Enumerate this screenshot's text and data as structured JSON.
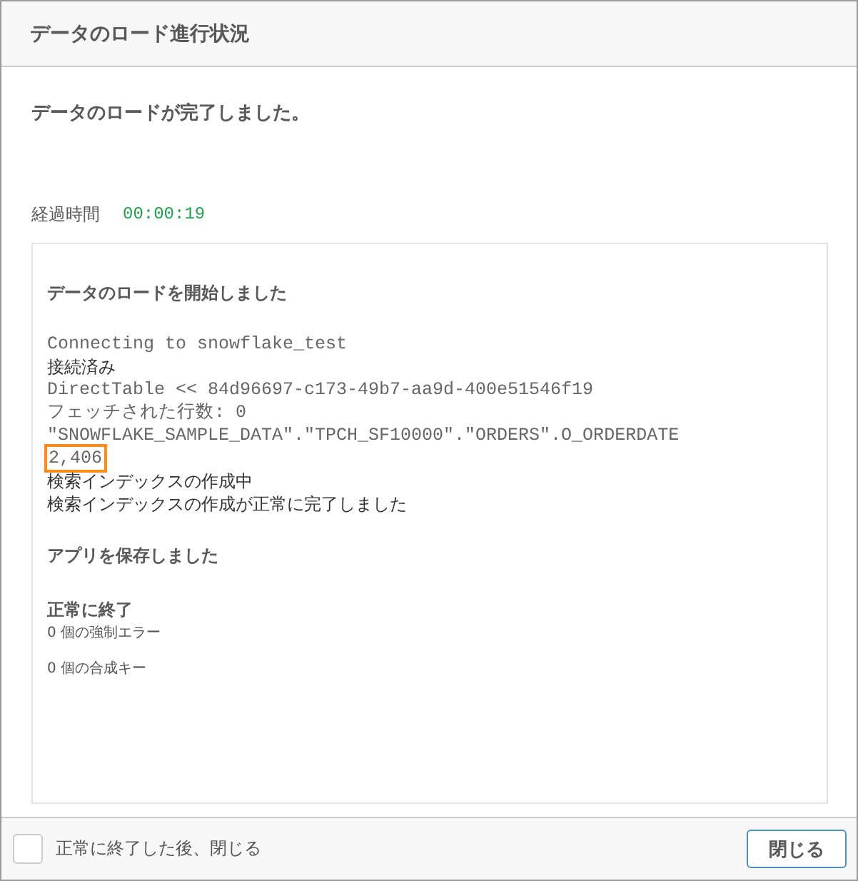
{
  "window": {
    "title": "データのロード進行状況"
  },
  "status": "データのロードが完了しました。",
  "elapsed": {
    "label": "経過時間",
    "value": "00:00:19"
  },
  "log": [
    {
      "kind": "heading",
      "text": "データのロードを開始しました"
    },
    {
      "kind": "gap"
    },
    {
      "kind": "code",
      "text": "Connecting to snowflake_test",
      "highlighted": false
    },
    {
      "kind": "text",
      "text": "接続済み"
    },
    {
      "kind": "code",
      "text": "DirectTable << 84d96697-c173-49b7-aa9d-400e51546f19",
      "highlighted": false
    },
    {
      "kind": "code",
      "text": "フェッチされた行数: 0",
      "highlighted": false
    },
    {
      "kind": "code",
      "text": "\"SNOWFLAKE_SAMPLE_DATA\".\"TPCH_SF10000\".\"ORDERS\".O_ORDERDATE",
      "highlighted": false
    },
    {
      "kind": "code",
      "text": "2,406",
      "highlighted": true
    },
    {
      "kind": "text",
      "text": "検索インデックスの作成中"
    },
    {
      "kind": "text",
      "text": "検索インデックスの作成が正常に完了しました"
    },
    {
      "kind": "gap"
    },
    {
      "kind": "heading",
      "text": "アプリを保存しました"
    },
    {
      "kind": "gap"
    },
    {
      "kind": "heading",
      "text": "正常に終了"
    },
    {
      "kind": "count",
      "text": "0 個の強制エラー"
    },
    {
      "kind": "count",
      "text": "0 個の合成キー"
    }
  ],
  "footer": {
    "checkbox": {
      "label": "正常に終了した後、閉じる",
      "checked": false
    },
    "close_button": "閉じる"
  }
}
